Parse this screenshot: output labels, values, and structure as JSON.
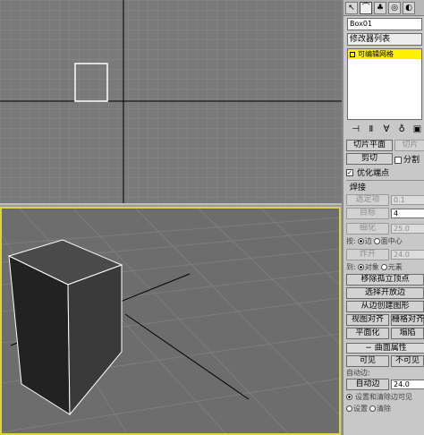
{
  "tabs": [
    "cursor-icon",
    "bend-icon",
    "hierarchy-icon",
    "motion-icon",
    "display-icon"
  ],
  "object_name": "Box01",
  "modifier_list_label": "修改器列表",
  "stack_item": "可编辑网格",
  "stack_tools": [
    "-p-",
    "| ƒ",
    "♂",
    "♀",
    "◻"
  ],
  "edit_geometry": {
    "slice_plane": "切片平面",
    "slice_plane_2": "切片",
    "cut": "剪切",
    "split": "分割",
    "refine_ends": "优化端点",
    "weld_label": "焊接",
    "selected": "选定项",
    "selected_val": "0.1",
    "target": "目标",
    "target_val": "4",
    "tessellate": "细化",
    "tess_val": "25.0",
    "by_label": "按:",
    "edge": "边",
    "face_center": "面中心",
    "explode": "炸开",
    "explode_val": "24.0",
    "to_label": "到:",
    "objects": "对象",
    "elements": "元素",
    "remove_isolated": "移除孤立顶点",
    "select_open_edges": "选择开放边",
    "create_shape": "从边创建图形",
    "view_align": "视图对齐",
    "grid_align": "栅格对齐",
    "planarize": "平面化",
    "collapse": "塌陷"
  },
  "surface_props": {
    "header": "曲面属性",
    "visible": "可见",
    "invisible": "不可见",
    "auto_edge_label": "自动边:",
    "auto_edge": "自动边",
    "auto_edge_val": "24.0",
    "set_clear": "设置和清除边可见",
    "set": "设置",
    "clear": "清除"
  }
}
